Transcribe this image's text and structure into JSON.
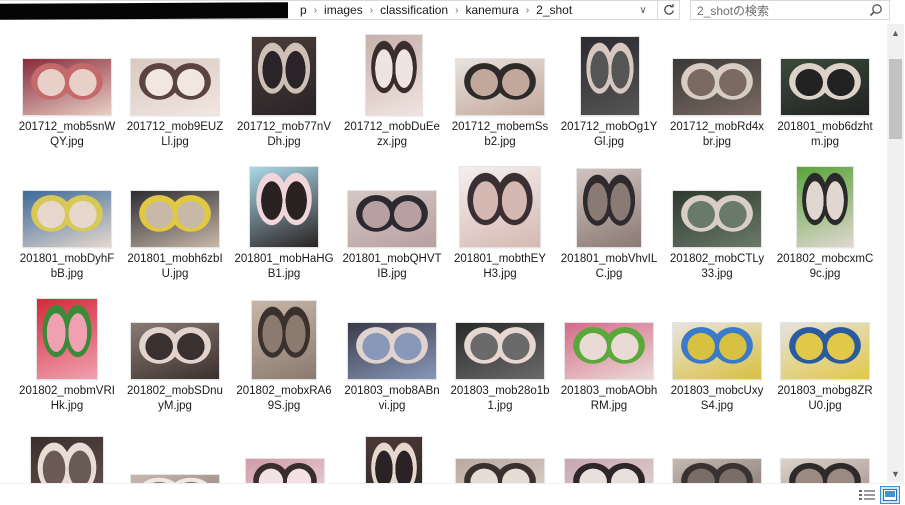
{
  "address": {
    "crumbs": [
      "p",
      "images",
      "classification",
      "kanemura",
      "2_shot"
    ]
  },
  "search": {
    "placeholder": "2_shotの検索"
  },
  "files": [
    {
      "name": "201712_mob5snWQY.jpg"
    },
    {
      "name": "201712_mob9EUZLl.jpg"
    },
    {
      "name": "201712_mob77nVDh.jpg"
    },
    {
      "name": "201712_mobDuEezx.jpg"
    },
    {
      "name": "201712_mobemSsb2.jpg"
    },
    {
      "name": "201712_mobOg1YGl.jpg"
    },
    {
      "name": "201712_mobRd4xbr.jpg"
    },
    {
      "name": "201801_mob6dzhtm.jpg"
    },
    {
      "name": "201801_mobDyhFbB.jpg"
    },
    {
      "name": "201801_mobh6zbIU.jpg"
    },
    {
      "name": "201801_mobHaHGB1.jpg"
    },
    {
      "name": "201801_mobQHVTIB.jpg"
    },
    {
      "name": "201801_mobthEYH3.jpg"
    },
    {
      "name": "201801_mobVhvILC.jpg"
    },
    {
      "name": "201802_mobCTLy33.jpg"
    },
    {
      "name": "201802_mobcxmC9c.jpg"
    },
    {
      "name": "201802_mobmVRIHk.jpg"
    },
    {
      "name": "201802_mobSDnuyM.jpg"
    },
    {
      "name": "201802_mobxRA69S.jpg"
    },
    {
      "name": "201803_mob8ABnvi.jpg"
    },
    {
      "name": "201803_mob28o1b1.jpg"
    },
    {
      "name": "201803_mobAObhRM.jpg"
    },
    {
      "name": "201803_mobcUxyS4.jpg"
    },
    {
      "name": "201803_mobg8ZRU0.jpg"
    },
    {
      "name": ""
    },
    {
      "name": ""
    },
    {
      "name": ""
    },
    {
      "name": ""
    },
    {
      "name": ""
    },
    {
      "name": ""
    },
    {
      "name": ""
    },
    {
      "name": ""
    }
  ],
  "icons": {
    "dropdown": "chevron-down-icon",
    "refresh": "refresh-icon",
    "search": "search-icon",
    "details_view": "details-view-icon",
    "thumbnail_view": "large-icons-view-icon"
  },
  "colors": {
    "selected_view": "#cfe6fb",
    "selected_border": "#3c8fd6"
  }
}
